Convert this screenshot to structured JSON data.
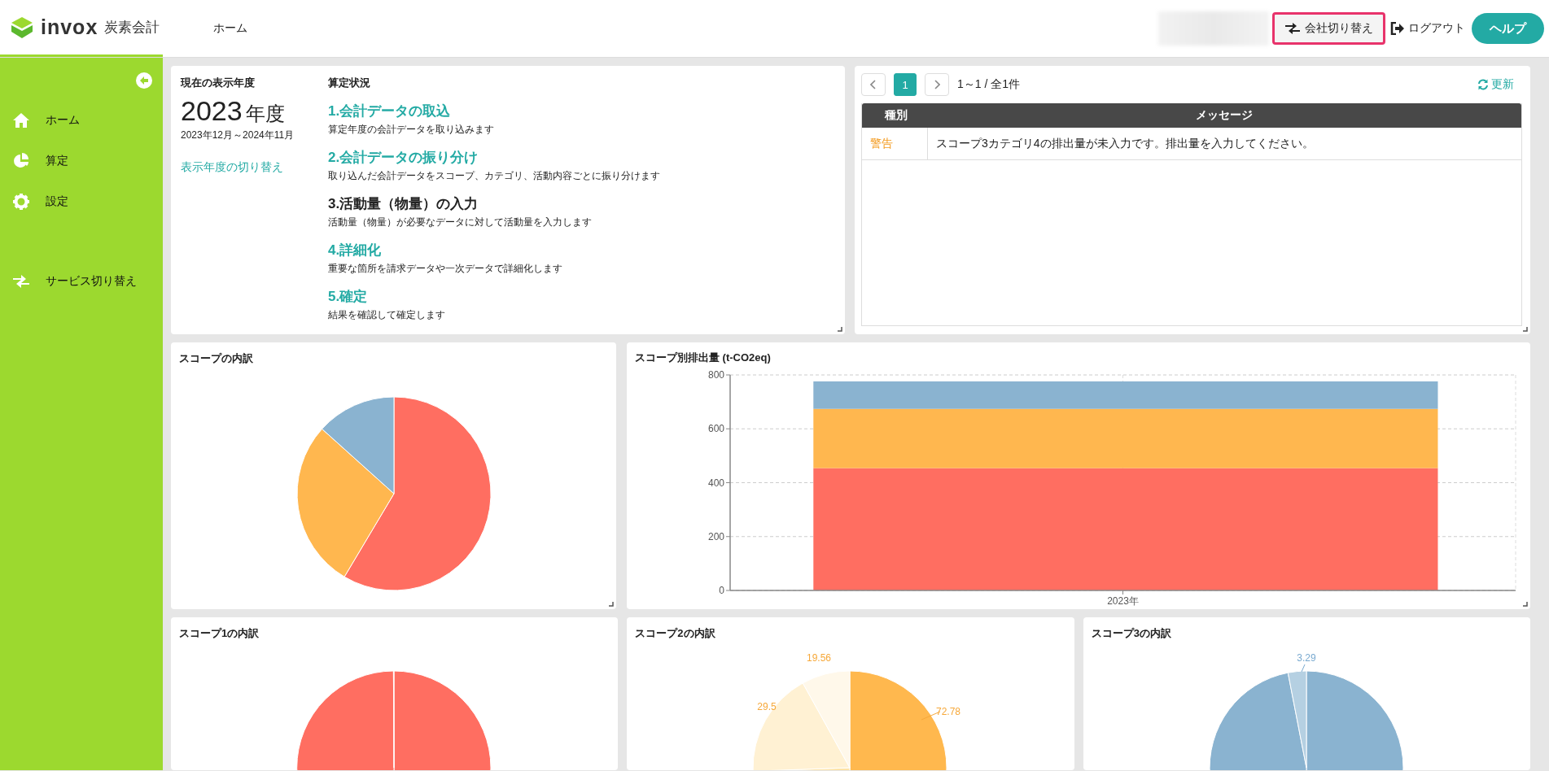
{
  "header": {
    "brand": "invox",
    "product": "炭素会計",
    "nav": [
      {
        "label": "ホーム"
      }
    ],
    "company_switch": "会社切り替え",
    "logout": "ログアウト",
    "help": "ヘルプ"
  },
  "sidebar": {
    "items": [
      {
        "label": "ホーム"
      },
      {
        "label": "算定"
      },
      {
        "label": "設定"
      }
    ],
    "footer_items": [
      {
        "label": "サービス切り替え"
      }
    ]
  },
  "year_panel": {
    "heading": "現在の表示年度",
    "year": "2023",
    "year_suffix": "年度",
    "period": "2023年12月～2024年11月",
    "switch_link": "表示年度の切り替え"
  },
  "progress": {
    "heading": "算定状況",
    "steps": [
      {
        "title": "1.会計データの取込",
        "description": "算定年度の会計データを取り込みます",
        "current": false
      },
      {
        "title": "2.会計データの振り分け",
        "description": "取り込んだ会計データをスコープ、カテゴリ、活動内容ごとに振り分けます",
        "current": false
      },
      {
        "title": "3.活動量（物量）の入力",
        "description": "活動量（物量）が必要なデータに対して活動量を入力します",
        "current": true
      },
      {
        "title": "4.詳細化",
        "description": "重要な箇所を請求データや一次データで詳細化します",
        "current": false
      },
      {
        "title": "5.確定",
        "description": "結果を確認して確定します",
        "current": false
      }
    ]
  },
  "messages": {
    "pages": [
      {
        "label": "1",
        "selected": true
      }
    ],
    "range": "1～1 / 全1件",
    "refresh": "更新",
    "columns": [
      "種別",
      "メッセージ"
    ],
    "rows": [
      {
        "type": "警告",
        "kind": "warning",
        "message": "スコープ3カテゴリ4の排出量が未入力です。排出量を入力してください。"
      }
    ]
  },
  "scope_breakdown": {
    "title": "スコープの内訳"
  },
  "emissions_by_scope": {
    "title": "スコープ別排出量 (t-CO2eq)",
    "chart_data": {
      "type": "bar",
      "categories": [
        "2023年"
      ],
      "stacked": true,
      "grid": true,
      "ylim": [
        0,
        800
      ],
      "yticks": [
        0,
        200,
        400,
        600,
        800
      ],
      "series": [
        {
          "color": "#ff6e61",
          "values": [
            454
          ]
        },
        {
          "color": "#ffb74f",
          "values": [
            220
          ]
        },
        {
          "color": "#8ab3d0",
          "values": [
            102
          ]
        }
      ]
    }
  },
  "scope1": {
    "title": "スコープ1の内訳"
  },
  "scope2": {
    "title": "スコープ2の内訳",
    "value_labels": [
      "19.56",
      "29.5",
      "72.78"
    ]
  },
  "scope3": {
    "title": "スコープ3の内訳",
    "value_labels": [
      "3.29"
    ]
  }
}
